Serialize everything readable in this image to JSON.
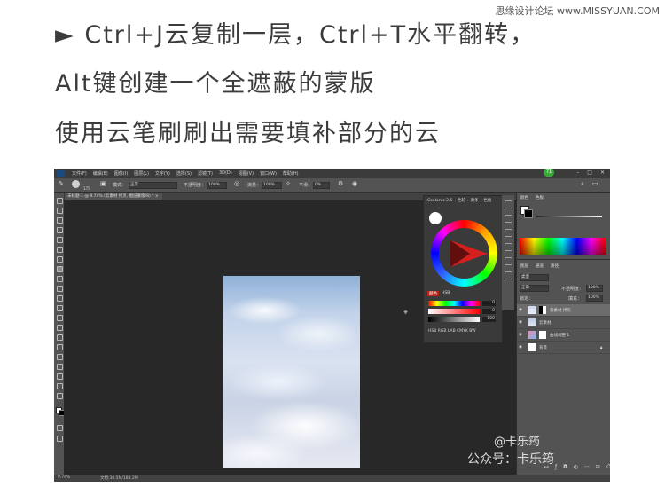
{
  "article": {
    "line1": "► Ctrl+J云复制一层，Ctrl+T水平翻转，",
    "line2": "Alt键创建一个全遮蔽的蒙版",
    "line3": "使用云笔刷刷出需要填补部分的云"
  },
  "watermark_top": "思缘设计论坛 www.MISSYUAN.COM",
  "photoshop": {
    "menu": [
      "文件(F)",
      "编辑(E)",
      "图像(I)",
      "图层(L)",
      "文字(Y)",
      "选择(S)",
      "滤镜(T)",
      "3D(D)",
      "视图(V)",
      "窗口(W)",
      "帮助(H)"
    ],
    "badge": "71",
    "window_controls": [
      "–",
      "□",
      "✕"
    ],
    "options": {
      "brush_size": "175",
      "mode_label": "模式：",
      "mode_value": "正常",
      "opacity_label": "不透明度：",
      "opacity_value": "100%",
      "flow_label": "流量：",
      "flow_value": "100%",
      "smoothing_label": "平滑：",
      "smoothing_value": "0%"
    },
    "doc_tab": "未标题-1 @ 9.74% (云素材 拷贝, 图层蒙版/8) * ×",
    "status": {
      "zoom": "9.74%",
      "doc": "文档:30.5M/188.2M"
    },
    "coolorus": {
      "title": "Coolorus 2.5 ∙ 色轮 ∙ 滑条 ∙ 色板",
      "tabs": [
        "颜色",
        "HSB",
        "RGB",
        "LAB",
        "CMYK",
        "BW"
      ],
      "slider_values": [
        "0",
        "0",
        "100"
      ],
      "modes": "HSB  RGB  LAB  CMYK  BW"
    },
    "right_panel": {
      "tabs": [
        "颜色",
        "色板"
      ],
      "layer_tabs": [
        "图层",
        "通道",
        "路径"
      ],
      "kind_label": "类型",
      "blend_mode": "正常",
      "opacity_label": "不透明度：",
      "opacity_value": "100%",
      "lock_label": "锁定：",
      "fill_label": "填充：",
      "fill_value": "100%",
      "layers": [
        {
          "name": "云素材 拷贝",
          "selected": true
        },
        {
          "name": "云素材",
          "selected": false
        },
        {
          "name": "曲线调整 1",
          "selected": false
        },
        {
          "name": "背景",
          "selected": false
        }
      ]
    },
    "watermark": {
      "handle": "@卡乐筠",
      "account": "公众号：卡乐筠"
    }
  },
  "colors": {
    "accent_red": "#b52a1a",
    "ps_bg": "#535353",
    "canvas_bg": "#282828"
  }
}
